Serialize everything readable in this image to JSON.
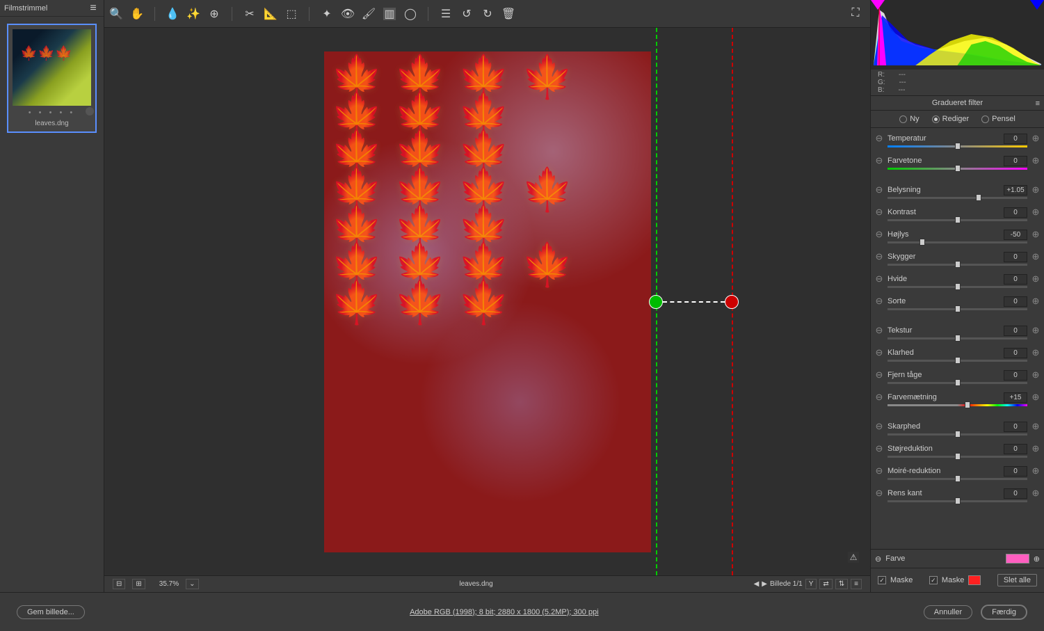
{
  "filmstrip": {
    "title": "Filmstrimmel",
    "thumb_name": "leaves.dng",
    "stars": "• • • • •"
  },
  "zoom": "35.7%",
  "image_name_bottom": "leaves.dng",
  "nav_text": "Billede 1/1",
  "rgb": {
    "r": "R:",
    "g": "G:",
    "b": "B:",
    "dash": "---"
  },
  "panel_title": "Gradueret filter",
  "modes": {
    "new": "Ny",
    "edit": "Rediger",
    "brush": "Pensel"
  },
  "sliders": {
    "temp": {
      "label": "Temperatur",
      "value": "0",
      "pos": 50
    },
    "tint": {
      "label": "Farvetone",
      "value": "0",
      "pos": 50
    },
    "exposure": {
      "label": "Belysning",
      "value": "+1.05",
      "pos": 65
    },
    "contrast": {
      "label": "Kontrast",
      "value": "0",
      "pos": 50
    },
    "highlights": {
      "label": "Højlys",
      "value": "-50",
      "pos": 25
    },
    "shadows": {
      "label": "Skygger",
      "value": "0",
      "pos": 50
    },
    "whites": {
      "label": "Hvide",
      "value": "0",
      "pos": 50
    },
    "blacks": {
      "label": "Sorte",
      "value": "0",
      "pos": 50
    },
    "texture": {
      "label": "Tekstur",
      "value": "0",
      "pos": 50
    },
    "clarity": {
      "label": "Klarhed",
      "value": "0",
      "pos": 50
    },
    "dehaze": {
      "label": "Fjern tåge",
      "value": "0",
      "pos": 50
    },
    "saturation": {
      "label": "Farvemætning",
      "value": "+15",
      "pos": 57
    },
    "sharpness": {
      "label": "Skarphed",
      "value": "0",
      "pos": 50
    },
    "noise": {
      "label": "Støjreduktion",
      "value": "0",
      "pos": 50
    },
    "moire": {
      "label": "Moiré-reduktion",
      "value": "0",
      "pos": 50
    },
    "defringe": {
      "label": "Rens kant",
      "value": "0",
      "pos": 50
    }
  },
  "color_label": "Farve",
  "color_swatch": "#ff5ec0",
  "mask_label": "Maske",
  "mask_swatch": "#ff2020",
  "clear_all": "Slet alle",
  "footer": {
    "save_image": "Gem billede...",
    "info": "Adobe RGB (1998); 8 bit; 2880 x 1800 (5.2MP); 300 ppi",
    "cancel": "Annuller",
    "done": "Færdig"
  }
}
